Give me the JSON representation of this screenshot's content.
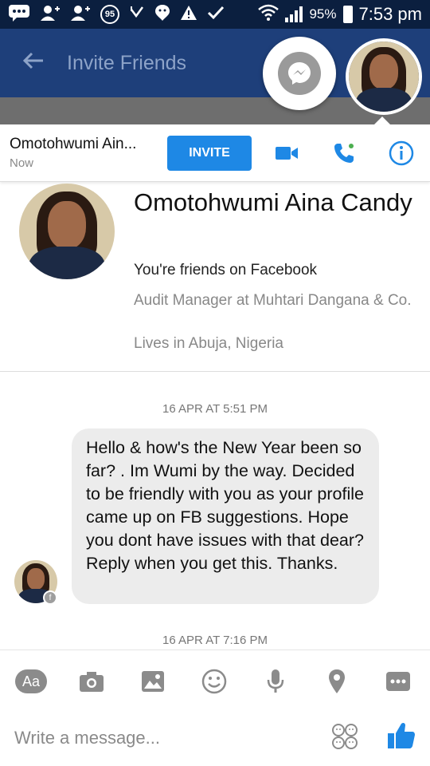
{
  "status_bar": {
    "notification_count": "95",
    "battery": "95%",
    "time": "7:53 pm"
  },
  "header": {
    "title": "Invite Friends"
  },
  "conversation": {
    "name": "Omotohwumi Ain...",
    "status": "Now",
    "invite_label": "INVITE"
  },
  "profile": {
    "name": "Omotohwumi Aina Candy",
    "friends_text": "You're friends on Facebook",
    "job": "Audit Manager at Muhtari Dangana & Co.",
    "location": "Lives in Abuja, Nigeria"
  },
  "messages": [
    {
      "timestamp": "16 APR AT 5:51 PM",
      "text": "Hello & how's the New Year been so far? . Im Wumi by the way. Decided to be friendly with you as your profile came up on FB suggestions. Hope you dont have issues with that dear? Reply when you get this. Thanks."
    },
    {
      "timestamp": "16 APR AT 7:16 PM"
    }
  ],
  "composer": {
    "aa_label": "Aa",
    "placeholder": "Write a message..."
  },
  "colors": {
    "accent": "#1e88e5",
    "header": "#1e3f7a",
    "status_bar": "#0b1f3f"
  }
}
